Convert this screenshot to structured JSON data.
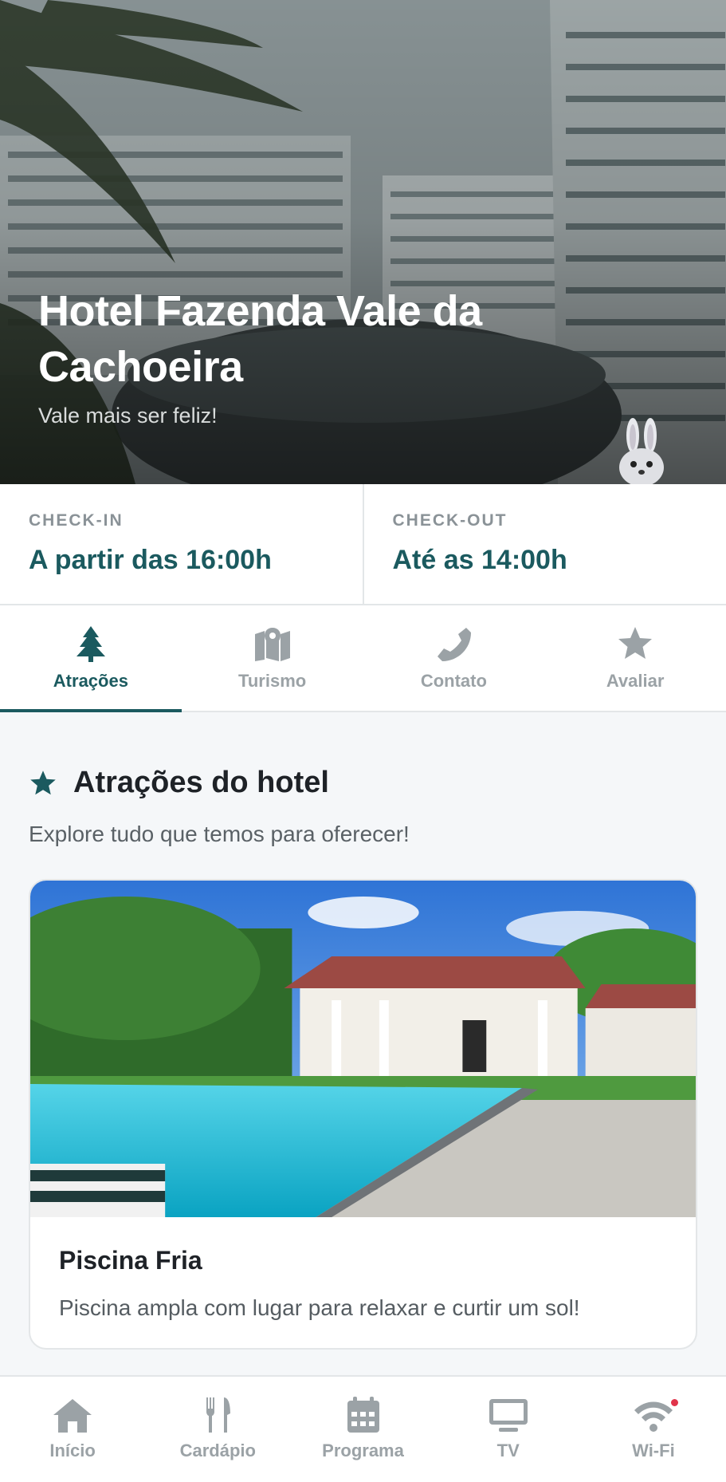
{
  "hero": {
    "title": "Hotel Fazenda Vale da Cachoeira",
    "subtitle": "Vale mais ser feliz!"
  },
  "checkin": {
    "label": "CHECK-IN",
    "value": "A partir das 16:00h"
  },
  "checkout": {
    "label": "CHECK-OUT",
    "value": "Até as 14:00h"
  },
  "tabs": [
    {
      "label": "Atrações",
      "icon": "tree-icon",
      "active": true
    },
    {
      "label": "Turismo",
      "icon": "map-icon",
      "active": false
    },
    {
      "label": "Contato",
      "icon": "phone-icon",
      "active": false
    },
    {
      "label": "Avaliar",
      "icon": "star-icon",
      "active": false
    }
  ],
  "section": {
    "title": "Atrações do hotel",
    "subtitle": "Explore tudo que temos para oferecer!"
  },
  "attractions": [
    {
      "title": "Piscina Fria",
      "description": "Piscina ampla com lugar para relaxar e curtir um sol!"
    }
  ],
  "bottom_nav": [
    {
      "label": "Início",
      "icon": "home-icon"
    },
    {
      "label": "Cardápio",
      "icon": "utensils-icon"
    },
    {
      "label": "Programa",
      "icon": "calendar-icon"
    },
    {
      "label": "TV",
      "icon": "tv-icon"
    },
    {
      "label": "Wi-Fi",
      "icon": "wifi-icon"
    }
  ],
  "colors": {
    "accent": "#1b5a5f",
    "inactive": "#9ba2a6",
    "notification": "#e0344a"
  }
}
